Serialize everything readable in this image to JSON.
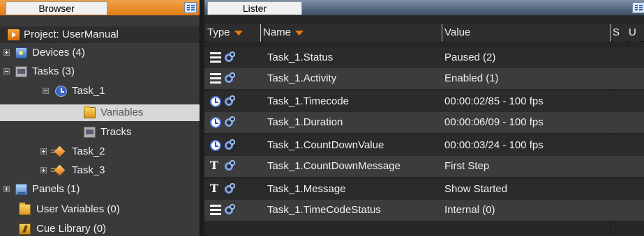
{
  "browser": {
    "tab_label": "Browser",
    "tree": [
      {
        "label": "Project: UserManual",
        "icon": "project-icon"
      },
      {
        "label": "Devices (4)",
        "icon": "devices-icon",
        "expander": "plus"
      },
      {
        "label": "Tasks (3)",
        "icon": "tasks-icon",
        "expander": "minus"
      },
      {
        "label": "Task_1",
        "icon": "clock-icon",
        "expander": "minus"
      },
      {
        "label": "Variables",
        "icon": "variables-folder-icon",
        "selected": true
      },
      {
        "label": "Tracks",
        "icon": "tracks-icon"
      },
      {
        "label": "Task_2",
        "icon": "task-icon",
        "expander": "plus"
      },
      {
        "label": "Task_3",
        "icon": "task-icon",
        "expander": "plus"
      },
      {
        "label": "Panels (1)",
        "icon": "panels-icon",
        "expander": "plus"
      },
      {
        "label": "User Variables (0)",
        "icon": "user-variables-folder-icon"
      },
      {
        "label": "Cue Library (0)",
        "icon": "cue-library-icon"
      }
    ]
  },
  "lister": {
    "tab_label": "Lister",
    "columns": {
      "type": "Type",
      "name": "Name",
      "value": "Value",
      "s": "S",
      "u": "U"
    },
    "rows": [
      {
        "type_icon": "list-icon",
        "name": "Task_1.Status",
        "value": "Paused (2)"
      },
      {
        "type_icon": "list-icon",
        "name": "Task_1.Activity",
        "value": "Enabled (1)"
      },
      {
        "type_icon": "clock-icon",
        "name": "Task_1.Timecode",
        "value": "00:00:02/85 - 100 fps"
      },
      {
        "type_icon": "clock-icon",
        "name": "Task_1.Duration",
        "value": "00:00:06/09 - 100 fps"
      },
      {
        "type_icon": "clock-icon",
        "name": "Task_1.CountDownValue",
        "value": "00:00:03/24 - 100 fps"
      },
      {
        "type_icon": "text-icon",
        "name": "Task_1.CountDownMessage",
        "value": "First Step"
      },
      {
        "type_icon": "text-icon",
        "name": "Task_1.Message",
        "value": "Show Started"
      },
      {
        "type_icon": "list-icon",
        "name": "Task_1.TimeCodeStatus",
        "value": "Internal (0)"
      }
    ]
  },
  "colors": {
    "browser_tab_accent": "#e27c12",
    "lister_tab_accent": "#3c4c66",
    "selected_row": "#d7d7d7",
    "sort_arrow": "#e87a10"
  }
}
